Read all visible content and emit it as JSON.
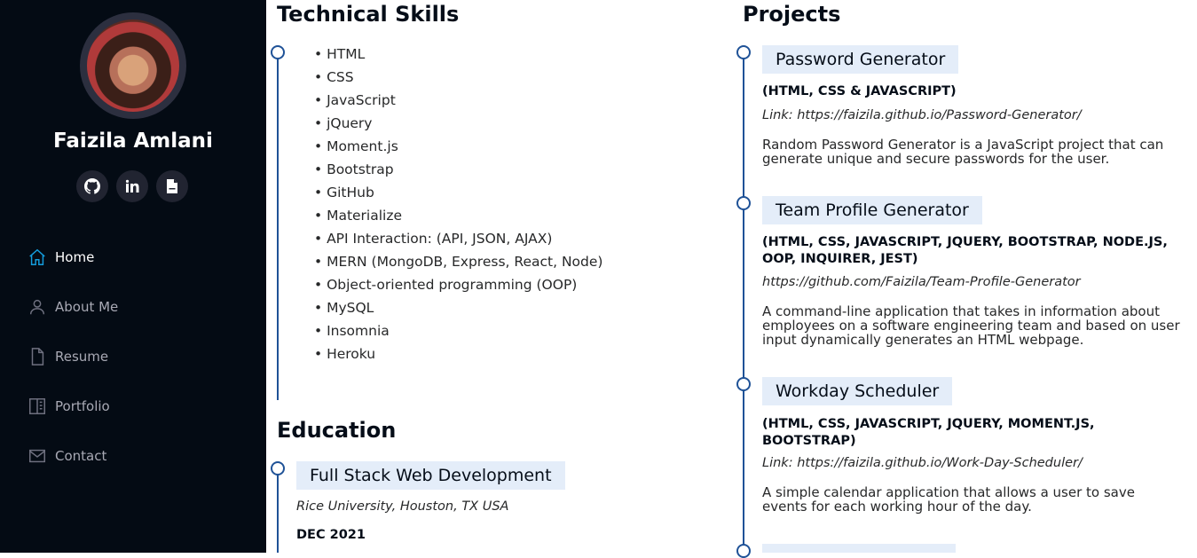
{
  "profile": {
    "name": "Faizila Amlani",
    "socials": [
      {
        "icon": "github-icon",
        "glyph": "◉"
      },
      {
        "icon": "linkedin-icon",
        "glyph": "in"
      },
      {
        "icon": "resume-file-icon",
        "glyph": "▤"
      }
    ]
  },
  "nav": {
    "items": [
      {
        "label": "Home",
        "icon": "home-icon",
        "active": true
      },
      {
        "label": "About Me",
        "icon": "person-icon",
        "active": false
      },
      {
        "label": "Resume",
        "icon": "file-icon",
        "active": false
      },
      {
        "label": "Portfolio",
        "icon": "portfolio-icon",
        "active": false
      },
      {
        "label": "Contact",
        "icon": "envelope-icon",
        "active": false
      }
    ]
  },
  "skills": {
    "title": "Technical Skills",
    "items": [
      "• HTML",
      "• CSS",
      "• JavaScript",
      "• jQuery",
      "• Moment.js",
      "• Bootstrap",
      "• GitHub",
      "• Materialize",
      "• API Interaction: (API, JSON, AJAX)",
      "• MERN (MongoDB, Express, React, Node)",
      "• Object-oriented programming (OOP)",
      "• MySQL",
      "• Insomnia",
      "• Heroku"
    ]
  },
  "education": {
    "title": "Education",
    "entries": [
      {
        "title": "Full Stack Web Development",
        "place": "Rice University, Houston, TX USA",
        "date": "DEC 2021"
      }
    ]
  },
  "projects": {
    "title": "Projects",
    "entries": [
      {
        "title": "Password Generator",
        "tech": "(HTML, CSS & JAVASCRIPT)",
        "link": "Link: https://faizila.github.io/Password-Generator/",
        "desc": "Random Password Generator is a JavaScript project that can generate unique and secure passwords for the user."
      },
      {
        "title": "Team Profile Generator",
        "tech": "(HTML, CSS, JAVASCRIPT, JQUERY, BOOTSTRAP, NODE.JS, OOP, INQUIRER, JEST)",
        "link": "https://github.com/Faizila/Team-Profile-Generator",
        "desc": "A command-line application that takes in information about employees on a software engineering team and based on user input dynamically generates an HTML webpage."
      },
      {
        "title": "Workday Scheduler",
        "tech": "(HTML, CSS, JAVASCRIPT, JQUERY, MOMENT.JS, BOOTSTRAP)",
        "link": "Link: https://faizila.github.io/Work-Day-Scheduler/",
        "desc": "A simple calendar application that allows a user to save events for each working hour of the day."
      }
    ]
  },
  "colors": {
    "sidebar_bg": "#040b14",
    "accent": "#149ddd",
    "timeline": "#1f5297",
    "entry_title_bg": "#e4edf9"
  }
}
